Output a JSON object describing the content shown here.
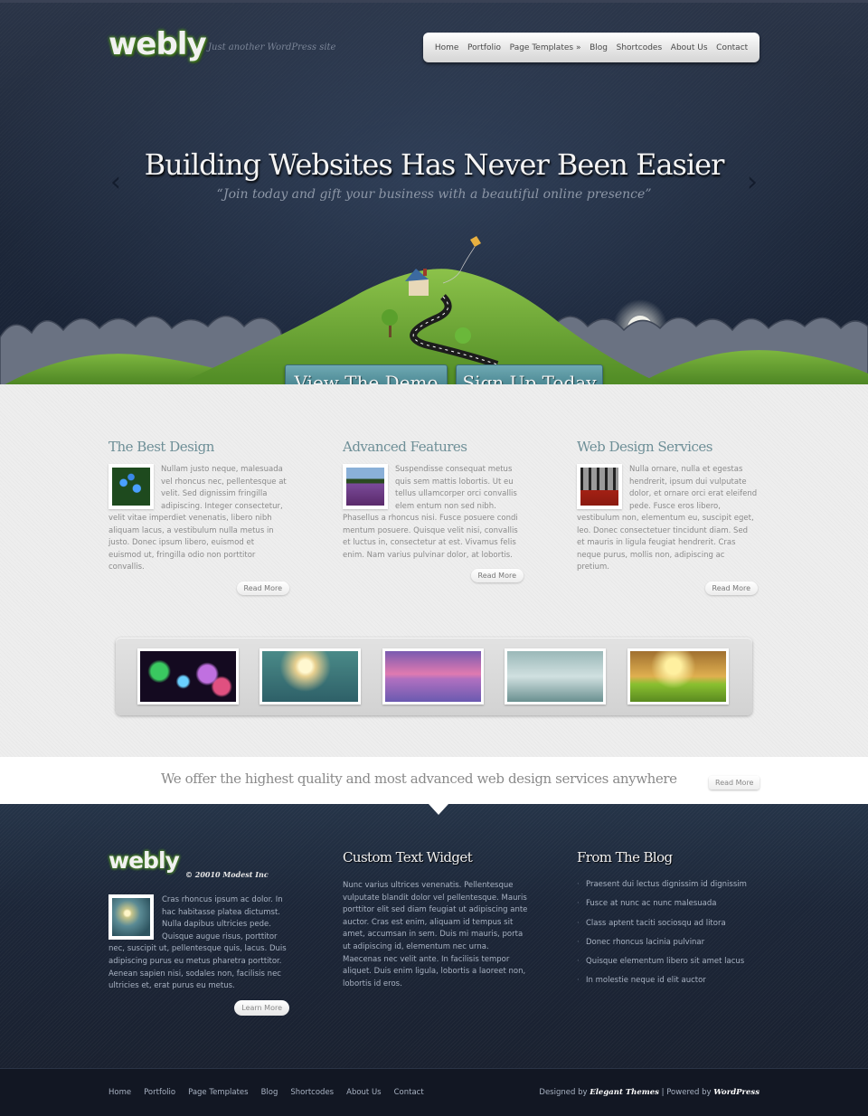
{
  "header": {
    "logo": "webly",
    "tagline": "Just another WordPress site",
    "nav": [
      "Home",
      "Portfolio",
      "Page Templates »",
      "Blog",
      "Shortcodes",
      "About Us",
      "Contact"
    ]
  },
  "hero": {
    "title": "Building Websites Has Never Been Easier",
    "subtitle": "“Join today and gift your business with a beautiful online presence”",
    "prev_icon": "chevron-left-icon",
    "next_icon": "chevron-right-icon",
    "buttons": {
      "demo": "View The Demo",
      "signup": "Sign Up Today"
    }
  },
  "features": [
    {
      "title": "The Best Design",
      "text": "Nullam justo neque, malesuada vel rhoncus nec, pellentesque at velit. Sed dignissim fringilla adipiscing. Integer consectetur, velit vitae imperdiet venenatis, libero nibh aliquam lacus, a vestibulum nulla metus in justo. Donec ipsum libero, euismod et euismod ut, fringilla odio non porttitor convallis.",
      "link": "Read More",
      "image": "blue-flowers"
    },
    {
      "title": "Advanced Features",
      "text": "Suspendisse consequat metus quis sem mattis lobortis. Ut eu tellus ullamcorper orci convallis elem entum non sed nibh. Phasellus a rhoncus nisi. Fusce posuere condi mentum posuere. Quisque velit nisi, convallis et luctus in, consectetur at est. Vivamus felis enim. Nam varius pulvinar dolor, at lobortis.",
      "link": "Read More",
      "image": "lavender-field"
    },
    {
      "title": "Web Design Services",
      "text": "Nulla ornare, nulla et egestas hendrerit, ipsum dui vulputate dolor, et ornare orci erat eleifend pede. Fusce eros libero, vestibulum non, elementum eu, suscipit eget, leo. Donec consectetuer tincidunt diam. Sed et mauris in ligula feugiat hendrerit. Cras neque purus, mollis non, adipiscing ac pretium.",
      "link": "Read More",
      "image": "red-forest"
    }
  ],
  "gallery": [
    "bokeh-lights",
    "dandelion",
    "bridge-sunset",
    "misty-lake",
    "tractor-field"
  ],
  "strip": {
    "text": "We offer the highest quality and most advanced web design services anywhere",
    "link": "Read More"
  },
  "footer": {
    "logo": "webly",
    "copyright": "© 20010 Modest Inc",
    "about_text": "Cras rhoncus ipsum ac dolor. In hac habitasse platea dictumst. Nulla dapibus ultricies pede. Quisque augue risus, porttitor nec, suscipit ut, pellentesque quis, lacus. Duis adipiscing purus eu metus pharetra porttitor. Aenean sapien nisi, sodales non, facilisis nec ultricies et, erat purus eu metus.",
    "about_link": "Learn More",
    "widget_title": "Custom Text Widget",
    "widget_text": "Nunc varius ultrices venenatis. Pellentesque vulputate blandit dolor vel pellentesque. Mauris porttitor elit sed diam feugiat ut adipiscing ante auctor. Cras est enim, aliquam id tempus sit amet, accumsan in sem. Duis mi mauris, porta ut adipiscing id, elementum nec urna. Maecenas nec velit ante. In facilisis tempor aliquet. Duis enim ligula, lobortis a laoreet non, lobortis id eros.",
    "blog_title": "From The Blog",
    "blog_posts": [
      "Praesent dui lectus dignissim id dignissim",
      "Fusce at nunc ac nunc malesuada",
      "Class aptent taciti sociosqu ad litora",
      "Donec rhoncus lacinia pulvinar",
      "Quisque elementum libero sit amet lacus",
      "In molestie neque id elit auctor"
    ]
  },
  "bottom": {
    "nav": [
      "Home",
      "Portfolio",
      "Page Templates",
      "Blog",
      "Shortcodes",
      "About Us",
      "Contact"
    ],
    "designed_by_label": "Designed by",
    "designer": "Elegant Themes",
    "separator": "|",
    "powered_by_label": "Powered by",
    "platform": "WordPress"
  }
}
